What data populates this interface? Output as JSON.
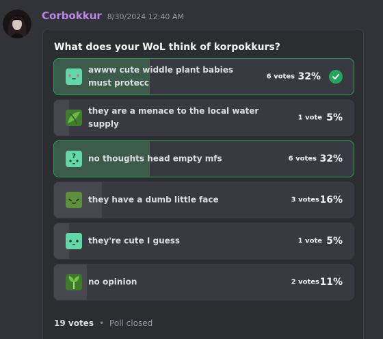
{
  "author": {
    "username": "Corbokkur",
    "timestamp": "8/30/2024 12:40 AM",
    "color": "#b687e8"
  },
  "poll": {
    "question": "What does your WoL think of korpokkurs?",
    "answers": [
      {
        "text": "awww cute widdle plant babies must protecc",
        "votes": "6 votes",
        "percent": "32%",
        "fraction": 0.32,
        "winner": true,
        "icon": "korpokkur-hearts-icon"
      },
      {
        "text": "they are a menace to the local water supply",
        "votes": "1 vote",
        "percent": "5%",
        "fraction": 0.05,
        "winner": false,
        "icon": "korpokkur-leaves-icon"
      },
      {
        "text": "no thoughts head empty mfs",
        "votes": "6 votes",
        "percent": "32%",
        "fraction": 0.32,
        "winner": true,
        "icon": "korpokkur-question-icon"
      },
      {
        "text": "they have a dumb little face",
        "votes": "3 votes",
        "percent": "16%",
        "fraction": 0.16,
        "winner": false,
        "icon": "korpokkur-face-icon"
      },
      {
        "text": "they're cute I guess",
        "votes": "1 vote",
        "percent": "5%",
        "fraction": 0.05,
        "winner": false,
        "icon": "korpokkur-cute-icon"
      },
      {
        "text": "no opinion",
        "votes": "2 votes",
        "percent": "11%",
        "fraction": 0.11,
        "winner": false,
        "icon": "korpokkur-sprout-icon"
      }
    ],
    "total_votes": "19 votes",
    "separator": "•",
    "status": "Poll closed"
  },
  "colors": {
    "winner_border": "#2f9e55",
    "winner_fill": "#3c5b4a",
    "check": "#23a55a"
  }
}
